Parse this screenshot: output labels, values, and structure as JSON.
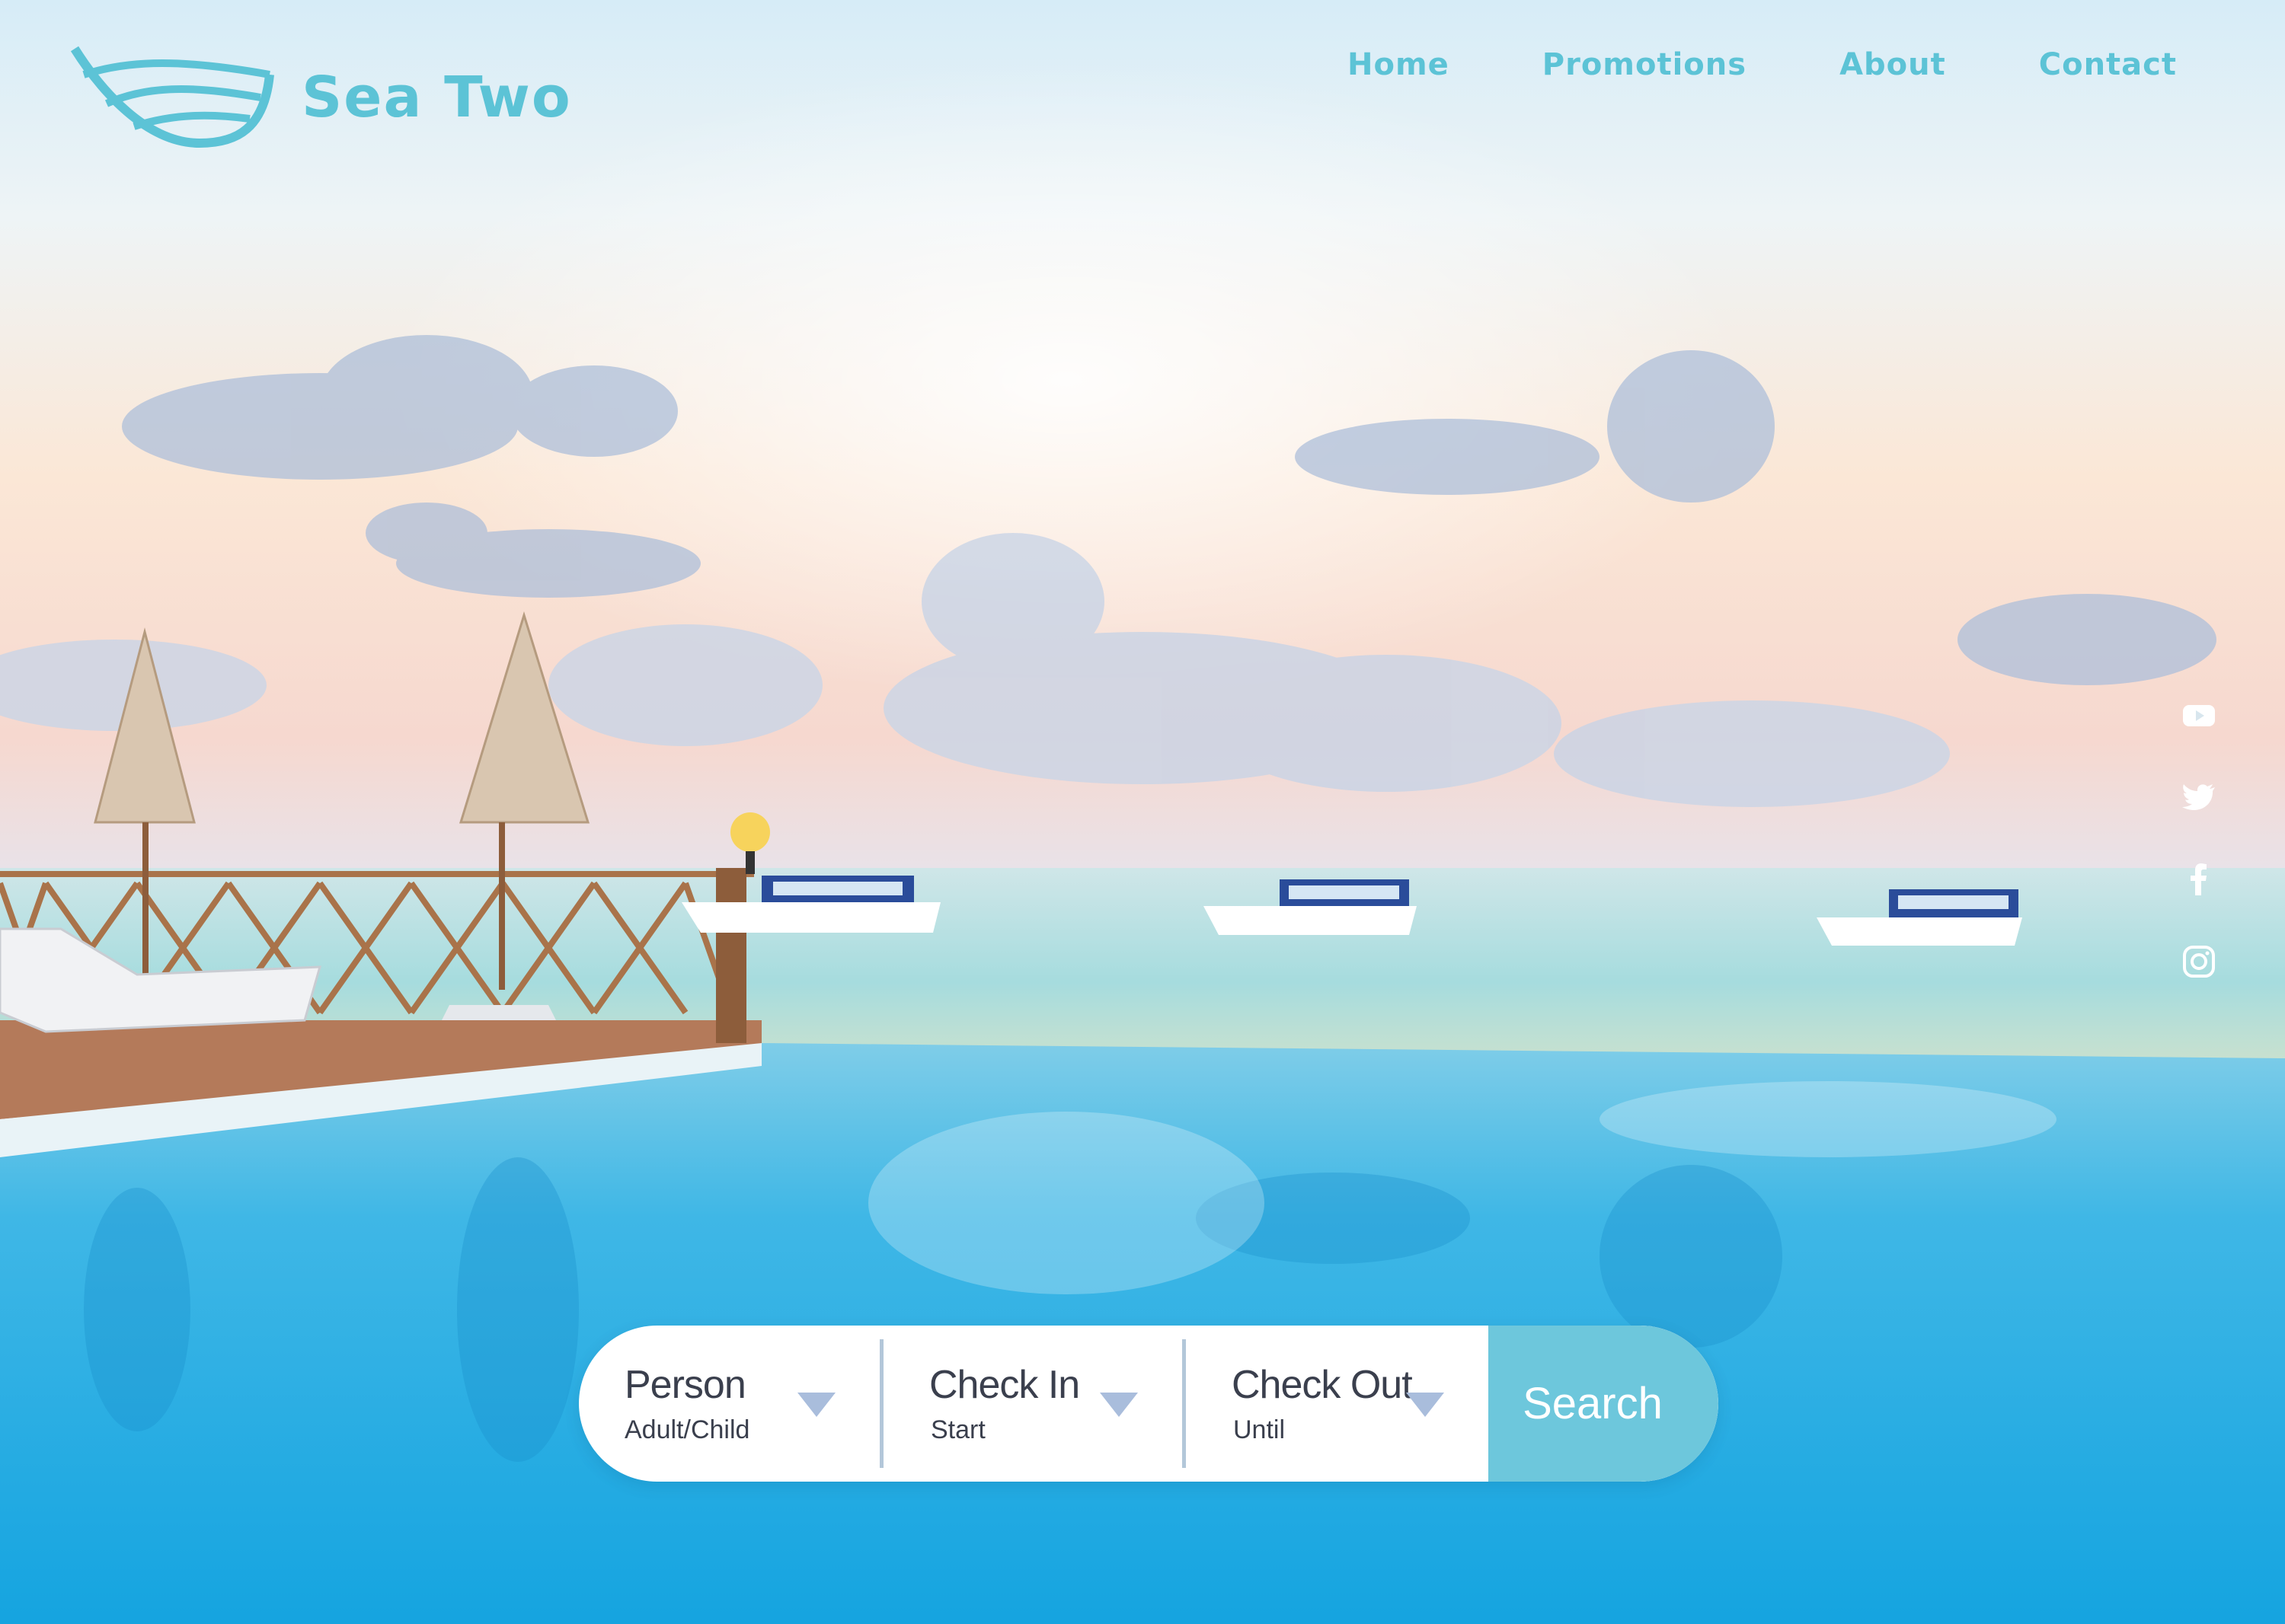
{
  "brand": {
    "name": "Sea Two",
    "icon": "wave-logo-icon",
    "accent": "#5cc3d6"
  },
  "nav": {
    "items": [
      {
        "label": "Home"
      },
      {
        "label": "Promotions"
      },
      {
        "label": "About"
      },
      {
        "label": "Contact"
      }
    ]
  },
  "social": [
    "youtube-icon",
    "twitter-icon",
    "facebook-icon",
    "instagram-icon"
  ],
  "booking": {
    "fields": [
      {
        "title": "Person",
        "sub": "Adult/Child"
      },
      {
        "title": "Check In",
        "sub": "Start"
      },
      {
        "title": "Check Out",
        "sub": "Until"
      }
    ],
    "search_label": "Search",
    "button_color": "#6dc7dc",
    "caret_color": "#a9bddc"
  }
}
